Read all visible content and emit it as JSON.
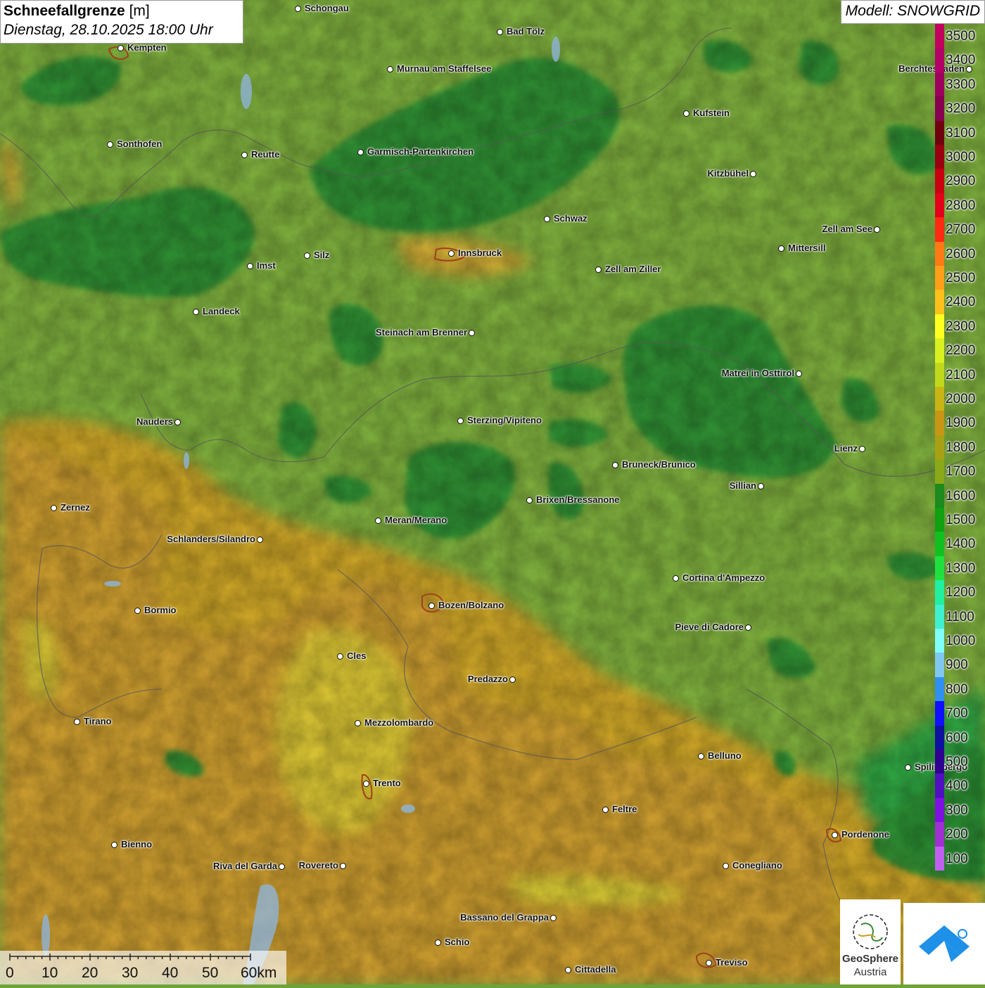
{
  "title": {
    "parameter": "Schneefallgrenze",
    "unit": "[m]",
    "datetime": "Dienstag, 28.10.2025 18:00 Uhr"
  },
  "model": "Modell: SNOWGRID",
  "legend": [
    {
      "value": "3500",
      "color": "#c2005e"
    },
    {
      "value": "3400",
      "color": "#b40066"
    },
    {
      "value": "3300",
      "color": "#9e005e"
    },
    {
      "value": "3200",
      "color": "#880050"
    },
    {
      "value": "3100",
      "color": "#6e0010"
    },
    {
      "value": "3000",
      "color": "#9a0010"
    },
    {
      "value": "2900",
      "color": "#c80010"
    },
    {
      "value": "2800",
      "color": "#e4001a"
    },
    {
      "value": "2700",
      "color": "#ff2a14"
    },
    {
      "value": "2600",
      "color": "#ff7a14"
    },
    {
      "value": "2500",
      "color": "#ff9e18"
    },
    {
      "value": "2400",
      "color": "#ffc01c"
    },
    {
      "value": "2300",
      "color": "#ffff20"
    },
    {
      "value": "2200",
      "color": "#d8f020"
    },
    {
      "value": "2100",
      "color": "#c0d81c"
    },
    {
      "value": "2000",
      "color": "#c8b414"
    },
    {
      "value": "1900",
      "color": "#c89614"
    },
    {
      "value": "1800",
      "color": "#a8a014"
    },
    {
      "value": "1700",
      "color": "#8aa818"
    },
    {
      "value": "1600",
      "color": "#1c8a1c"
    },
    {
      "value": "1500",
      "color": "#10a010"
    },
    {
      "value": "1400",
      "color": "#10c020"
    },
    {
      "value": "1300",
      "color": "#20e040"
    },
    {
      "value": "1200",
      "color": "#20f0a0"
    },
    {
      "value": "1100",
      "color": "#40f0d0"
    },
    {
      "value": "1000",
      "color": "#80fff8"
    },
    {
      "value": "900",
      "color": "#80c8f0"
    },
    {
      "value": "800",
      "color": "#3090f0"
    },
    {
      "value": "700",
      "color": "#1010ff"
    },
    {
      "value": "600",
      "color": "#1010a0"
    },
    {
      "value": "500",
      "color": "#300090"
    },
    {
      "value": "400",
      "color": "#5010c0"
    },
    {
      "value": "300",
      "color": "#8010e0"
    },
    {
      "value": "200",
      "color": "#a030d0"
    },
    {
      "value": "100",
      "color": "#c060f0"
    }
  ],
  "cities": [
    {
      "name": "Schongau",
      "side": "r"
    },
    {
      "name": "Bad Tölz",
      "side": "r"
    },
    {
      "name": "Kempten",
      "side": "r"
    },
    {
      "name": "Murnau am Staffelsee",
      "side": "r"
    },
    {
      "name": "Berchtesgaden",
      "side": "l"
    },
    {
      "name": "Kufstein",
      "side": "r"
    },
    {
      "name": "Sonthofen",
      "side": "r"
    },
    {
      "name": "Reutte",
      "side": "r"
    },
    {
      "name": "Garmisch-Partenkirchen",
      "side": "r"
    },
    {
      "name": "Kitzbühel",
      "side": "l"
    },
    {
      "name": "Schwaz",
      "side": "r"
    },
    {
      "name": "Zell am See",
      "side": "l"
    },
    {
      "name": "Mittersill",
      "side": "r"
    },
    {
      "name": "Innsbruck",
      "side": "r"
    },
    {
      "name": "Imst",
      "side": "r"
    },
    {
      "name": "Silz",
      "side": "r"
    },
    {
      "name": "Zell am Ziller",
      "side": "r"
    },
    {
      "name": "Landeck",
      "side": "r"
    },
    {
      "name": "Steinach am Brenner",
      "side": "l"
    },
    {
      "name": "Matrei in Osttirol",
      "side": "l"
    },
    {
      "name": "Nauders",
      "side": "l"
    },
    {
      "name": "Sterzing/Vipiteno",
      "side": "r"
    },
    {
      "name": "Lienz",
      "side": "l"
    },
    {
      "name": "Bruneck/Brunico",
      "side": "r"
    },
    {
      "name": "Sillian",
      "side": "l"
    },
    {
      "name": "Zernez",
      "side": "r"
    },
    {
      "name": "Brixen/Bressanone",
      "side": "r"
    },
    {
      "name": "Meran/Merano",
      "side": "r"
    },
    {
      "name": "Schlanders/Silandro",
      "side": "l"
    },
    {
      "name": "Cortina d'Ampezzo",
      "side": "r"
    },
    {
      "name": "Bozen/Bolzano",
      "side": "r"
    },
    {
      "name": "Bormio",
      "side": "r"
    },
    {
      "name": "Pieve di Cadore",
      "side": "l"
    },
    {
      "name": "Cles",
      "side": "r"
    },
    {
      "name": "Predazzo",
      "side": "l"
    },
    {
      "name": "Tirano",
      "side": "r"
    },
    {
      "name": "Mezzolombardo",
      "side": "r"
    },
    {
      "name": "Belluno",
      "side": "r"
    },
    {
      "name": "Spilimbergo",
      "side": "r"
    },
    {
      "name": "Trento",
      "side": "r"
    },
    {
      "name": "Feltre",
      "side": "r"
    },
    {
      "name": "Pordenone",
      "side": "r"
    },
    {
      "name": "Bienno",
      "side": "r"
    },
    {
      "name": "Riva del Garda",
      "side": "l"
    },
    {
      "name": "Rovereto",
      "side": "l"
    },
    {
      "name": "Conegliano",
      "side": "r"
    },
    {
      "name": "Bassano del Grappa",
      "side": "l"
    },
    {
      "name": "Schio",
      "side": "r"
    },
    {
      "name": "Treviso",
      "side": "r"
    },
    {
      "name": "Cittadella",
      "side": "r"
    }
  ],
  "scale_bar": {
    "ticks": [
      "0",
      "10",
      "20",
      "30",
      "40",
      "50",
      "60km"
    ]
  },
  "logos": {
    "geosphere_name_1": "GeoSphere",
    "geosphere_name_2": "Austria"
  }
}
